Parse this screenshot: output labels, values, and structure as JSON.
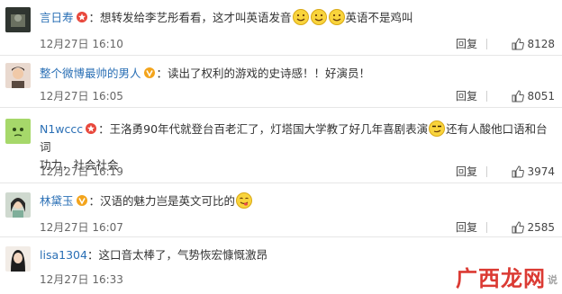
{
  "reply_label": "回复",
  "watermark": {
    "text": "广西龙网",
    "suffix": "说"
  },
  "comments": [
    {
      "user": "言日寿",
      "badge": "star",
      "text1": "：想转发给李艺彤看看，这才叫英语发音",
      "text2": "英语不是鸡叫",
      "emoji_count": 3,
      "emoji": "smile",
      "time": "12月27日 16:10",
      "likes": "8128"
    },
    {
      "user": "整个微博最帅的男人",
      "badge": "v",
      "text1": "：读出了权利的游戏的史诗感！！好演员！",
      "time": "12月27日 16:05",
      "likes": "8051"
    },
    {
      "user": "N1wccc",
      "badge": "star",
      "text1": "：王洛勇90年代就登台百老汇了，灯塔国大学教了好几年喜剧表演",
      "text2": "还有人酸他口语和台词",
      "text3": "功力，社会社会",
      "emoji": "smirk",
      "time": "12月27日 16:19",
      "likes": "3974"
    },
    {
      "user": "林黛玉",
      "badge": "v",
      "text1": "：汉语的魅力岂是英文可比的",
      "emoji": "yum",
      "time": "12月27日 16:07",
      "likes": "2585"
    },
    {
      "user": "lisa1304",
      "text1": "：这口音太棒了，气势恢宏慷慨激昂",
      "time": "12月27日 16:33",
      "likes": ""
    }
  ]
}
